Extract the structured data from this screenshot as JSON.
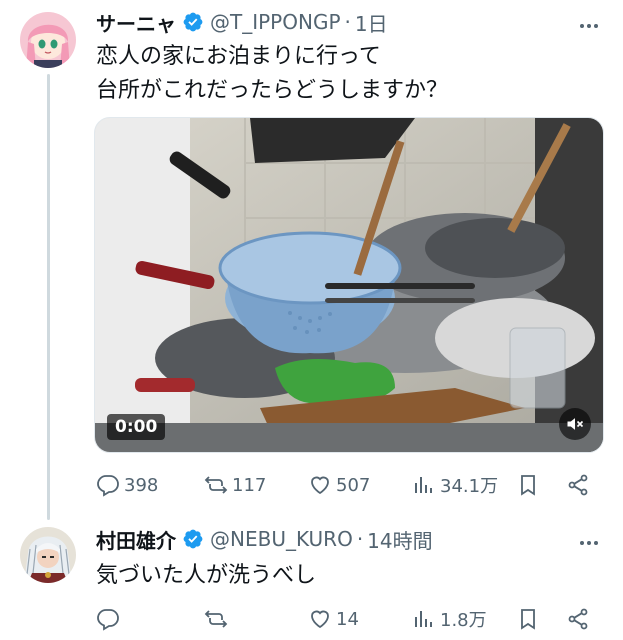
{
  "tweets": [
    {
      "name": "サーニャ",
      "handle": "@T_IPPONGP",
      "separator": "·",
      "time": "1日",
      "text_lines": [
        "恋人の家にお泊まりに行って",
        "台所がこれだったらどうしますか？"
      ],
      "media": {
        "timer": "0:00"
      },
      "counts": {
        "replies": "398",
        "retweets": "117",
        "likes": "507",
        "views": "34.1万"
      }
    },
    {
      "name": "村田雄介",
      "handle": "@NEBU_KURO",
      "separator": "·",
      "time": "14時間",
      "text_lines": [
        "気づいた人が洗うべし"
      ],
      "counts": {
        "replies": "",
        "retweets": "",
        "likes": "14",
        "views": "1.8万"
      }
    }
  ],
  "colors": {
    "verified": "#1d9bf0",
    "muted_text": "#536471",
    "thread_line": "#cfd9de"
  },
  "icons": [
    "verified-badge-icon",
    "more-icon",
    "reply-icon",
    "retweet-icon",
    "like-icon",
    "views-icon",
    "bookmark-icon",
    "share-icon",
    "mute-icon"
  ]
}
